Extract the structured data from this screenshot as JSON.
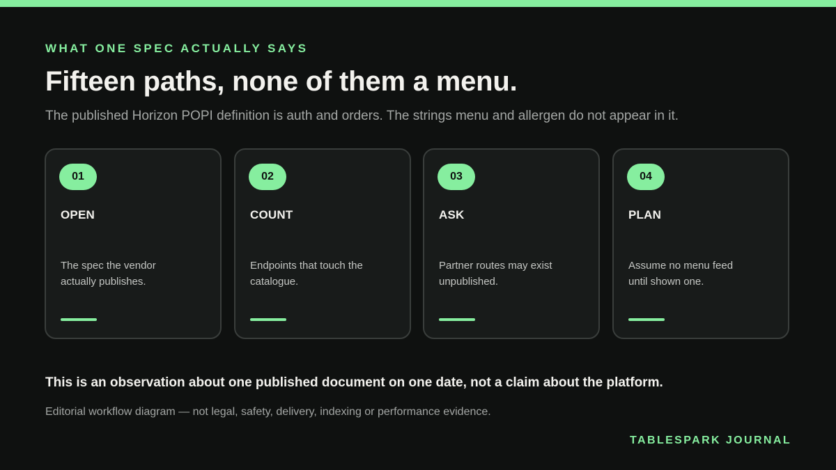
{
  "colors": {
    "accent": "#86ee9f",
    "background": "#0f1110",
    "card_background": "#181b1a",
    "card_border": "#3a3e3c",
    "text_primary": "#f3f2ee",
    "text_muted": "#a3a6a4"
  },
  "eyebrow": "WHAT ONE SPEC ACTUALLY SAYS",
  "title": "Fifteen paths, none of them a menu.",
  "subtitle": "The published Horizon POPI definition is auth and orders. The strings menu and allergen do not appear in it.",
  "steps": [
    {
      "number": "01",
      "title": "OPEN",
      "description": "The spec the vendor actually publishes."
    },
    {
      "number": "02",
      "title": "COUNT",
      "description": "Endpoints that touch the catalogue."
    },
    {
      "number": "03",
      "title": "ASK",
      "description": "Partner routes may exist unpublished."
    },
    {
      "number": "04",
      "title": "PLAN",
      "description": "Assume no menu feed until shown one."
    }
  ],
  "note": "This is an observation about one published document on one date, not a claim about the platform.",
  "disclaimer": "Editorial workflow diagram — not legal, safety, delivery, indexing or performance evidence.",
  "brand": "TABLESPARK JOURNAL"
}
